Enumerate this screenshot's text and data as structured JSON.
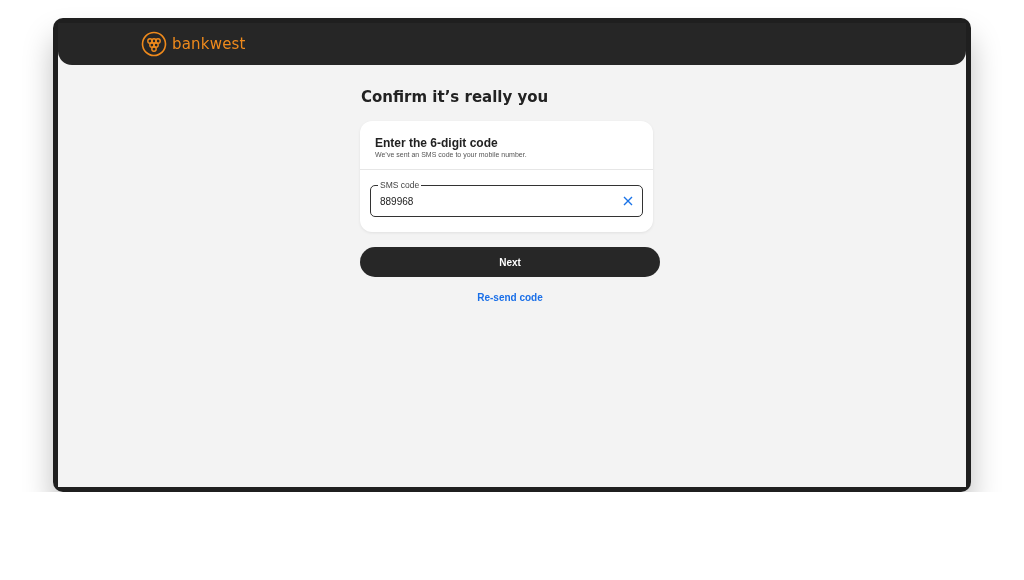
{
  "header": {
    "brand": "bankwest"
  },
  "page": {
    "title": "Confirm it’s really you"
  },
  "card": {
    "heading": "Enter the 6-digit code",
    "subtext": "We’ve sent an SMS code to your mobile number.",
    "field": {
      "label": "SMS code",
      "value": "889968"
    }
  },
  "buttons": {
    "primary": "Next",
    "link": "Re-send code"
  }
}
